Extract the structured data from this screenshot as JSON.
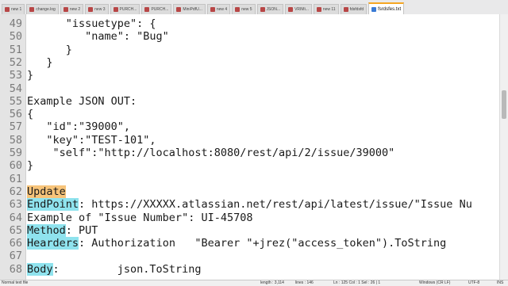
{
  "tabs": [
    {
      "label": "new 1"
    },
    {
      "label": "change.log"
    },
    {
      "label": "new 2"
    },
    {
      "label": "new 3"
    },
    {
      "label": "PURCH..."
    },
    {
      "label": "PURCH..."
    },
    {
      "label": "MiniPdfU..."
    },
    {
      "label": "new 4"
    },
    {
      "label": "new 5"
    },
    {
      "label": "JSON..."
    },
    {
      "label": "VRIMi..."
    },
    {
      "label": "new 11"
    },
    {
      "label": "fdsfdsfd"
    },
    {
      "label": "fsrdsfes.txt",
      "active": true
    }
  ],
  "lines": [
    {
      "num": "49",
      "parts": [
        {
          "t": "      \"issuetype\": {"
        }
      ]
    },
    {
      "num": "50",
      "parts": [
        {
          "t": "         \"name\": \"Bug\""
        }
      ]
    },
    {
      "num": "51",
      "parts": [
        {
          "t": "      }"
        }
      ]
    },
    {
      "num": "52",
      "parts": [
        {
          "t": "   }"
        }
      ]
    },
    {
      "num": "53",
      "parts": [
        {
          "t": "}"
        }
      ]
    },
    {
      "num": "54",
      "parts": [
        {
          "t": ""
        }
      ]
    },
    {
      "num": "55",
      "parts": [
        {
          "t": "Example JSON OUT:"
        }
      ]
    },
    {
      "num": "56",
      "parts": [
        {
          "t": "{"
        }
      ]
    },
    {
      "num": "57",
      "parts": [
        {
          "t": "   \"id\":\"39000\","
        }
      ]
    },
    {
      "num": "58",
      "parts": [
        {
          "t": "   \"key\":\"TEST-101\","
        }
      ]
    },
    {
      "num": "59",
      "parts": [
        {
          "t": "    \"self\":\"http://localhost:8080/rest/api/2/issue/39000\""
        }
      ]
    },
    {
      "num": "60",
      "parts": [
        {
          "t": "}"
        }
      ]
    },
    {
      "num": "61",
      "parts": [
        {
          "t": ""
        }
      ]
    },
    {
      "num": "62",
      "parts": [
        {
          "t": "Update",
          "hl": "orange"
        }
      ]
    },
    {
      "num": "63",
      "parts": [
        {
          "t": "EndPoint",
          "hl": "cyan"
        },
        {
          "t": ": https://XXXXX.atlassian.net/rest/api/latest/issue/\"Issue Nu"
        }
      ]
    },
    {
      "num": "64",
      "parts": [
        {
          "t": "Example of \"Issue Number\": UI-45708"
        }
      ]
    },
    {
      "num": "65",
      "parts": [
        {
          "t": "Method",
          "hl": "cyan"
        },
        {
          "t": ": PUT"
        }
      ]
    },
    {
      "num": "66",
      "parts": [
        {
          "t": "Hearders",
          "hl": "cyan"
        },
        {
          "t": ": Authorization   \"Bearer \"+jrez(\"access_token\").ToString"
        }
      ]
    },
    {
      "num": "67",
      "parts": [
        {
          "t": ""
        }
      ]
    },
    {
      "num": "68",
      "parts": [
        {
          "t": "Body",
          "hl": "cyan"
        },
        {
          "t": ":         json.ToString"
        }
      ]
    }
  ],
  "status": {
    "file_type": "Normal text file",
    "length": "length : 3,114",
    "lines": "lines : 146",
    "position": "Ln : 125    Col : 1    Sel : 26 | 1",
    "eol": "Windows (CR LF)",
    "encoding": "UTF-8",
    "mode": "INS"
  }
}
